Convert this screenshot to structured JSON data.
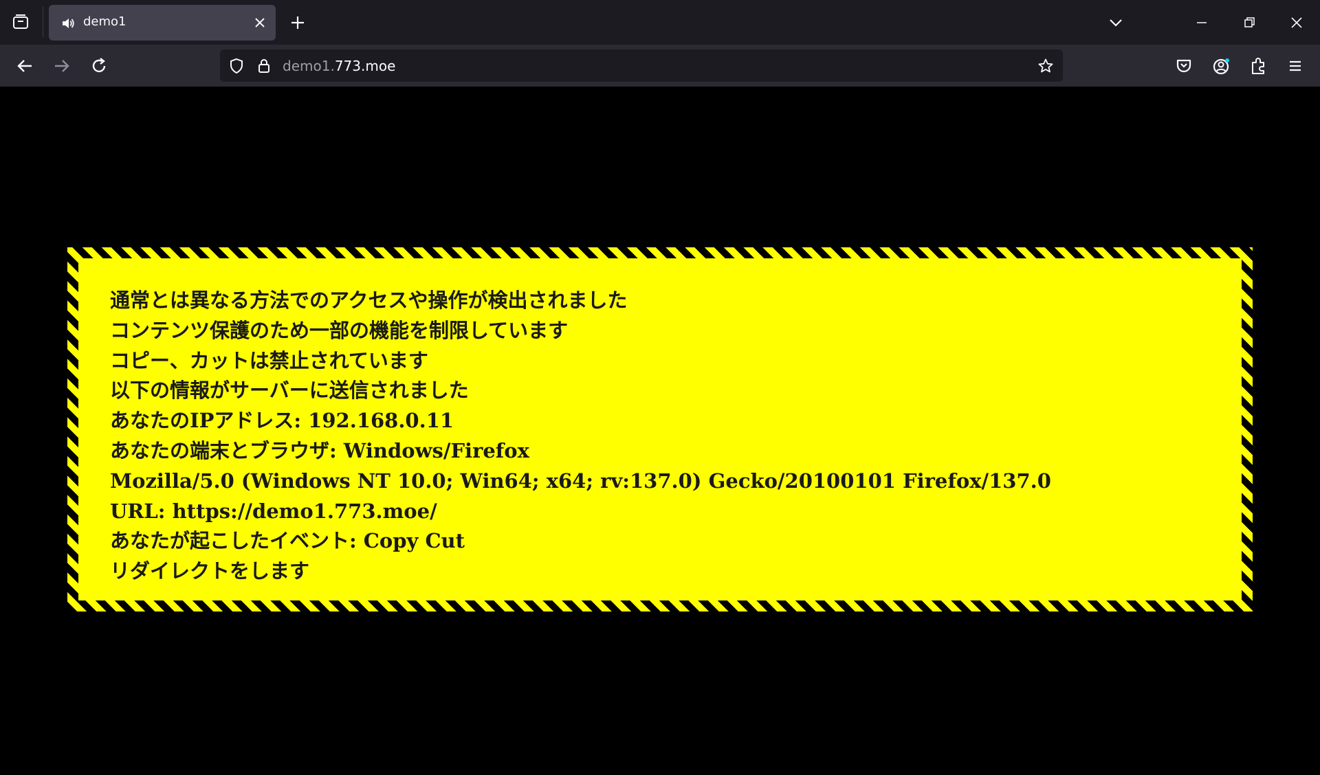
{
  "browser": {
    "tab": {
      "title": "demo1"
    },
    "url": {
      "prefix": "demo1.",
      "domain": "773.moe"
    }
  },
  "page": {
    "lines": [
      "通常とは異なる方法でのアクセスや操作が検出されました",
      "コンテンツ保護のため一部の機能を制限しています",
      "コピー、カットは禁止されています",
      "以下の情報がサーバーに送信されました",
      "あなたのIPアドレス: 192.168.0.11",
      "あなたの端末とブラウザ: Windows/Firefox",
      "Mozilla/5.0 (Windows NT 10.0; Win64; x64; rv:137.0) Gecko/20100101 Firefox/137.0",
      "URL: https://demo1.773.moe/",
      "あなたが起こしたイベント: Copy Cut",
      "リダイレクトをします"
    ]
  },
  "colors": {
    "banner": "#ffff00",
    "stripe": "#000000",
    "toolbar": "#2b2a33",
    "tabstrip": "#1c1b22"
  }
}
